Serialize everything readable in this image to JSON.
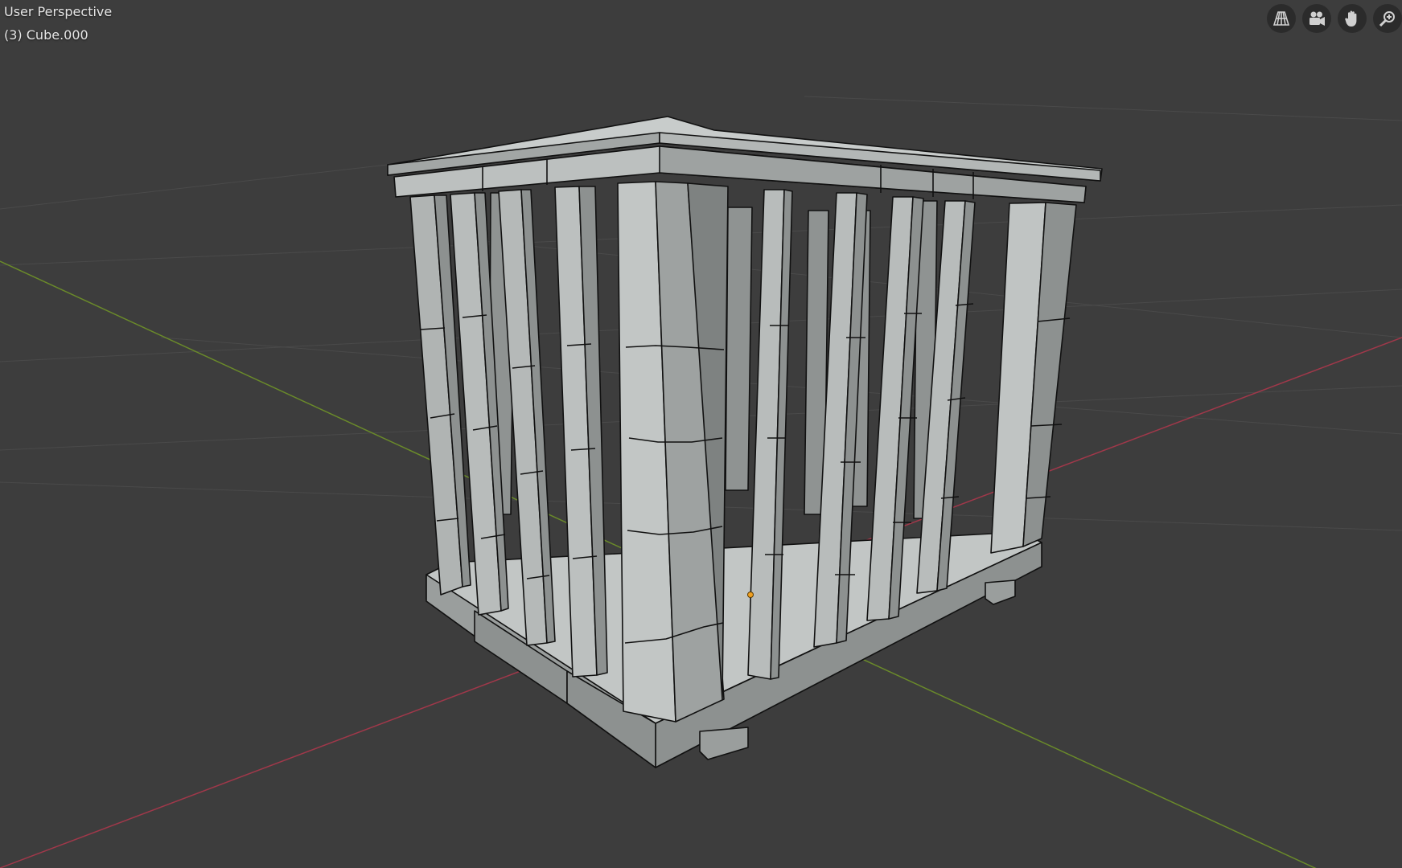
{
  "viewport": {
    "view_name": "User Perspective",
    "object_name": "(3) Cube.000",
    "nav_buttons": [
      {
        "name": "toggle-camera-orthographic",
        "icon": "grid-perspective-icon"
      },
      {
        "name": "camera-view",
        "icon": "camera-icon"
      },
      {
        "name": "pan-view",
        "icon": "hand-icon"
      },
      {
        "name": "zoom-view",
        "icon": "zoom-icon"
      }
    ]
  },
  "colors": {
    "background": "#3d3d3d",
    "grid": "#4a4a4a",
    "x_axis": "#a0384a",
    "y_axis": "#6a8a2a",
    "mesh_light": "#b8bcbb",
    "mesh_mid": "#9ea2a1",
    "mesh_dark": "#7e8281",
    "mesh_edge": "#111111",
    "origin_dot": "#f0a020"
  }
}
